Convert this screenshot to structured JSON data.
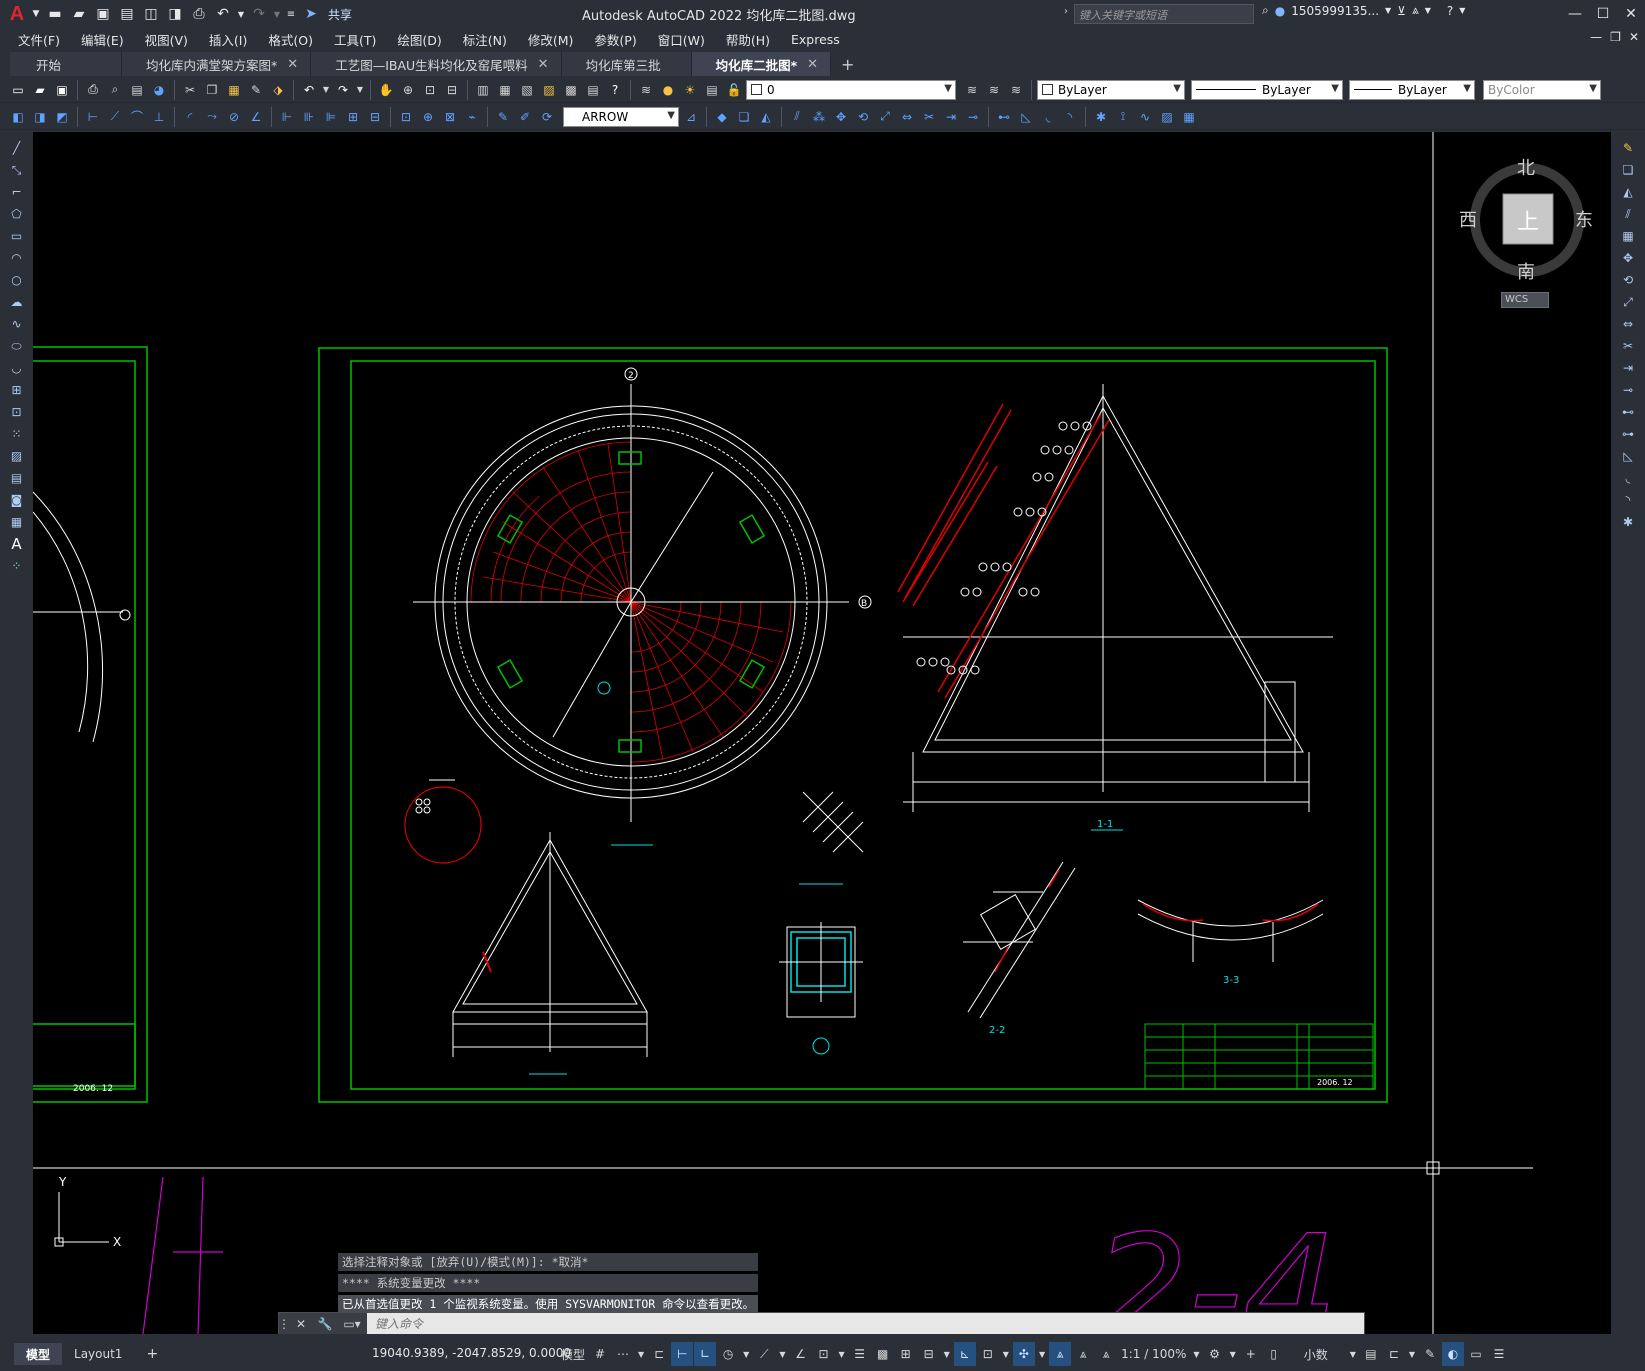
{
  "app": {
    "title": "Autodesk AutoCAD 2022    均化库二批图.dwg",
    "search_placeholder": "键入关键字或短语",
    "user": "1505999135...",
    "share_label": "共享"
  },
  "menu": [
    "文件(F)",
    "编辑(E)",
    "视图(V)",
    "插入(I)",
    "格式(O)",
    "工具(T)",
    "绘图(D)",
    "标注(N)",
    "修改(M)",
    "参数(P)",
    "窗口(W)",
    "帮助(H)",
    "Express"
  ],
  "tabs": [
    {
      "label": "开始",
      "closable": false,
      "active": false
    },
    {
      "label": "均化库内满堂架方案图*",
      "closable": true,
      "active": false
    },
    {
      "label": "工艺图—IBAU生料均化及窑尾喂料",
      "closable": true,
      "active": false
    },
    {
      "label": "均化库第三批",
      "closable": false,
      "active": false
    },
    {
      "label": "均化库二批图*",
      "closable": true,
      "active": true
    }
  ],
  "toolbar": {
    "layer_value": "0",
    "color_value": "ByLayer",
    "linetype_value": "ByLayer",
    "lineweight_value": "ByLayer",
    "plotstyle_value": "ByColor",
    "dimstyle_value": "ARROW"
  },
  "viewcube": {
    "north": "北",
    "south": "南",
    "east": "东",
    "west": "西",
    "top": "上",
    "wcs": "WCS"
  },
  "drawing_labels": {
    "section_1_1": "1-1",
    "section_2_2": "2-2",
    "section_3_3": "3-3",
    "title_date": "2006. 12",
    "big_text": "2-4",
    "grid_b": "B",
    "grid_2": "2"
  },
  "command": {
    "history": [
      "选择注释对象或 [放弃(U)/模式(M)]: *取消*",
      "**** 系统变量更改 ****",
      "已从首选值更改 1 个监视系统变量。使用 SYSVARMONITOR 命令以查看更改。"
    ],
    "placeholder": "键入命令"
  },
  "status": {
    "layout_tabs": [
      "模型",
      "Layout1"
    ],
    "coords": "19040.9389, -2047.8529, 0.0000",
    "model_label": "模型",
    "scale": "1:1 / 100%",
    "units": "小数"
  },
  "colors": {
    "ui_bg": "#2b2f38",
    "canvas_bg": "#000000",
    "frame_green": "#00c000",
    "red_lines": "#e00000",
    "magenta": "#d000d0",
    "cyan": "#00e0e0",
    "white": "#ffffff"
  }
}
